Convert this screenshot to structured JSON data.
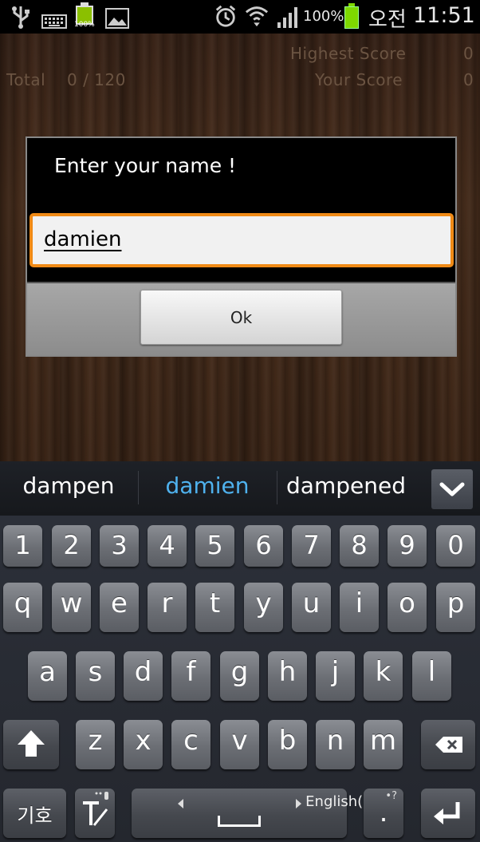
{
  "status_bar": {
    "battery_small_label": "100%",
    "battery_percent": "100%",
    "ampm": "오전",
    "time": "11:51",
    "icons": [
      "usb-icon",
      "keyboard-icon",
      "battery-icon",
      "gallery-icon",
      "alarm-icon",
      "wifi-icon",
      "signal-icon",
      "battery-icon"
    ]
  },
  "scores": {
    "total_label": "Total",
    "total_value": "0 / 120",
    "highest_label": "Highest Score",
    "highest_value": "0",
    "your_label": "Your Score",
    "your_value": "0"
  },
  "dialog": {
    "title": "Enter your name !",
    "input_value": "damien",
    "ok_label": "Ok"
  },
  "suggestions": {
    "items": [
      "dampen",
      "damien",
      "dampened"
    ],
    "active_index": 1,
    "collapse_icon": "chevron-down-icon"
  },
  "keyboard": {
    "row_numbers": [
      "1",
      "2",
      "3",
      "4",
      "5",
      "6",
      "7",
      "8",
      "9",
      "0"
    ],
    "row1": [
      "q",
      "w",
      "e",
      "r",
      "t",
      "y",
      "u",
      "i",
      "o",
      "p"
    ],
    "row2": [
      "a",
      "s",
      "d",
      "f",
      "g",
      "h",
      "j",
      "k",
      "l"
    ],
    "row3": [
      "z",
      "x",
      "c",
      "v",
      "b",
      "n",
      "m"
    ],
    "symbols_label": "기호",
    "space_language": "English(US)",
    "period_label": ".",
    "period_hint": "•?",
    "colors": {
      "accent": "#4fb2ee",
      "focus": "#f08a16",
      "key": "#6b6e74"
    }
  }
}
